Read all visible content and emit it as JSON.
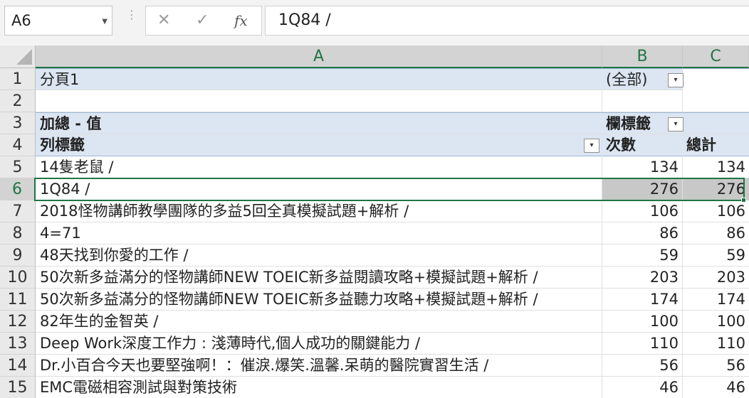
{
  "formula_bar": {
    "name_box": "A6",
    "dropdown_icon": "chevron-down-icon",
    "separator": "⋮",
    "cancel_icon": "✕",
    "enter_icon": "✓",
    "fx_label": "fx",
    "formula": "1Q84 /"
  },
  "columns": [
    "A",
    "B",
    "C"
  ],
  "rows": [
    "1",
    "2",
    "3",
    "4",
    "5",
    "6",
    "7",
    "8",
    "9",
    "10",
    "11",
    "12",
    "13",
    "14",
    "15"
  ],
  "pivot": {
    "page_label": "分頁1",
    "page_value": "(全部)",
    "sum_label": "加總 - 值",
    "col_label": "欄標籤",
    "row_label": "列標籤",
    "col_count": "次數",
    "col_total": "總計",
    "filter_icon": "▾",
    "data": [
      {
        "label": "14隻老鼠 /",
        "count": "134",
        "total": "134"
      },
      {
        "label": "1Q84 /",
        "count": "276",
        "total": "276"
      },
      {
        "label": "2018怪物講師教學團隊的多益5回全真模擬試題+解析 /",
        "count": "106",
        "total": "106"
      },
      {
        "label": "4=71",
        "count": "86",
        "total": "86"
      },
      {
        "label": "48天找到你愛的工作 /",
        "count": "59",
        "total": "59"
      },
      {
        "label": "50次新多益滿分的怪物講師NEW TOEIC新多益閱讀攻略+模擬試題+解析 /",
        "count": "203",
        "total": "203"
      },
      {
        "label": "50次新多益滿分的怪物講師NEW TOEIC新多益聽力攻略+模擬試題+解析 /",
        "count": "174",
        "total": "174"
      },
      {
        "label": "82年生的金智英 /",
        "count": "100",
        "total": "100"
      },
      {
        "label": "Deep Work深度工作力 : 淺薄時代,個人成功的關鍵能力 /",
        "count": "110",
        "total": "110"
      },
      {
        "label": "Dr.小百合今天也要堅強啊！：催淚.爆笑.溫馨.呆萌的醫院實習生活 /",
        "count": "56",
        "total": "56"
      },
      {
        "label": "EMC電磁相容測試與對策技術",
        "count": "46",
        "total": "46"
      }
    ]
  },
  "colors": {
    "accent": "#217346",
    "pivot_header": "#dce6f2",
    "selection_fill": "#c8c8c8"
  }
}
